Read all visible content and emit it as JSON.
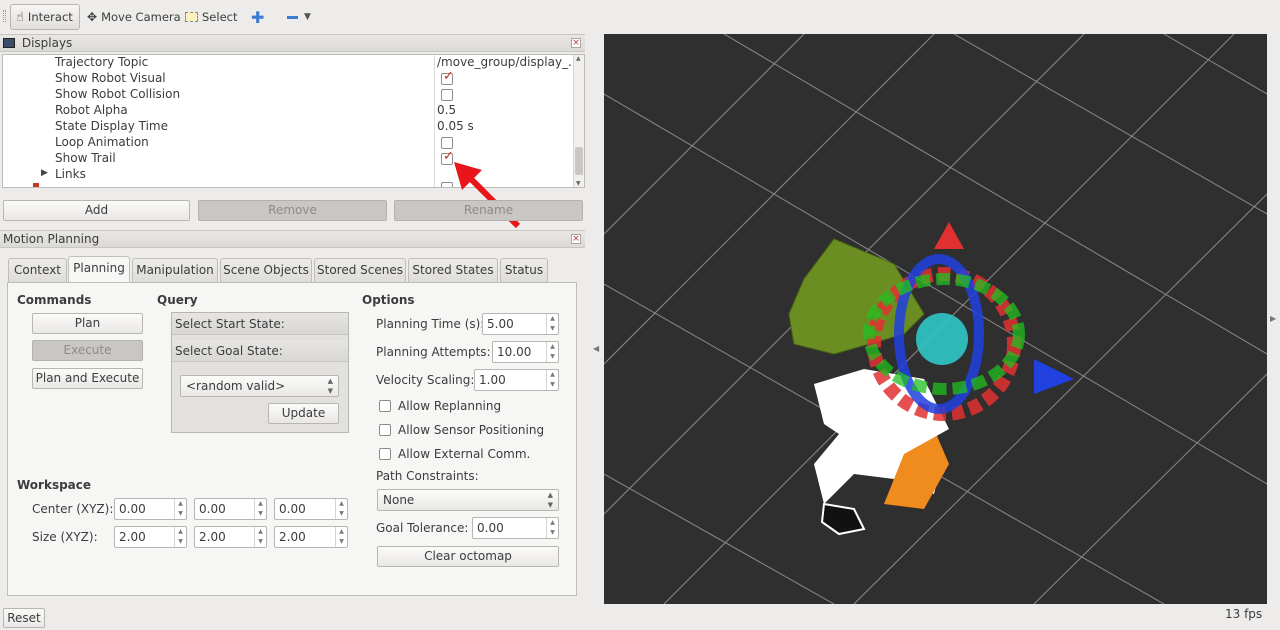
{
  "toolbar": {
    "interact": "Interact",
    "move_camera": "Move Camera",
    "select": "Select"
  },
  "displays": {
    "title": "Displays",
    "rows": [
      {
        "name": "Trajectory Topic",
        "value": "/move_group/display_..."
      },
      {
        "name": "Show Robot Visual",
        "value": "checked"
      },
      {
        "name": "Show Robot Collision",
        "value": "unchecked"
      },
      {
        "name": "Robot Alpha",
        "value": "0.5"
      },
      {
        "name": "State Display Time",
        "value": "0.05 s"
      },
      {
        "name": "Loop Animation",
        "value": "unchecked"
      },
      {
        "name": "Show Trail",
        "value": "checked"
      },
      {
        "name": "Links",
        "value": ""
      }
    ],
    "add": "Add",
    "remove": "Remove",
    "rename": "Rename"
  },
  "motion_planning": {
    "title": "Motion Planning",
    "tabs": [
      "Context",
      "Planning",
      "Manipulation",
      "Scene Objects",
      "Stored Scenes",
      "Stored States",
      "Status"
    ],
    "selected_tab": "Planning",
    "commands": {
      "title": "Commands",
      "plan": "Plan",
      "execute": "Execute",
      "plan_execute": "Plan and Execute"
    },
    "query": {
      "title": "Query",
      "start_state": "Select Start State:",
      "goal_state": "Select Goal State:",
      "goal_value": "<random valid>",
      "update": "Update"
    },
    "options": {
      "title": "Options",
      "planning_time_label": "Planning Time (s):",
      "planning_time": "5.00",
      "planning_attempts_label": "Planning Attempts:",
      "planning_attempts": "10.00",
      "velocity_scaling_label": "Velocity Scaling:",
      "velocity_scaling": "1.00",
      "allow_replanning": "Allow Replanning",
      "allow_sensor": "Allow Sensor Positioning",
      "allow_external": "Allow External Comm.",
      "path_constraints_label": "Path Constraints:",
      "path_constraints": "None",
      "goal_tolerance_label": "Goal Tolerance:",
      "goal_tolerance": "0.00",
      "clear_octomap": "Clear octomap"
    },
    "workspace": {
      "title": "Workspace",
      "center_label": "Center (XYZ):",
      "center": [
        "0.00",
        "0.00",
        "0.00"
      ],
      "size_label": "Size (XYZ):",
      "size": [
        "2.00",
        "2.00",
        "2.00"
      ]
    }
  },
  "status": {
    "reset": "Reset",
    "fps": "13 fps"
  },
  "colors": {
    "viewport_bg": "#2f2f2f",
    "check_red": "#d0261c",
    "arrow_red": "#e8161a"
  }
}
